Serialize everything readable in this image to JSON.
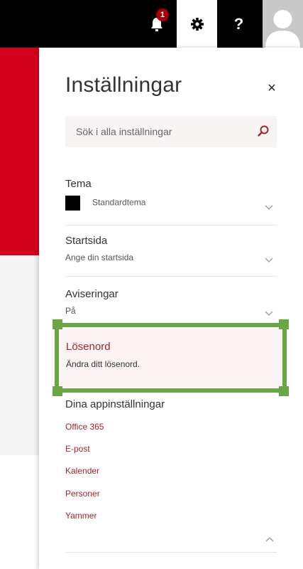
{
  "topbar": {
    "notification_count": "1",
    "help_label": "?",
    "icons": [
      "bell-icon",
      "gear-icon",
      "help-icon",
      "avatar-icon"
    ]
  },
  "settings": {
    "title": "Inställningar",
    "close_label": "×",
    "search": {
      "placeholder": "Sök i alla inställningar"
    },
    "theme": {
      "label": "Tema",
      "value": "Standardtema"
    },
    "start_page": {
      "label": "Startsida",
      "value": "Ange din startsida"
    },
    "notifications": {
      "label": "Aviseringar",
      "value": "På"
    },
    "password": {
      "label": "Lösenord",
      "value": "Ändra ditt lösenord."
    },
    "app_settings": {
      "label": "Dina appinställningar",
      "items": [
        "Office 365",
        "E-post",
        "Kalender",
        "Personer",
        "Yammer"
      ]
    }
  },
  "colors": {
    "accent": "#a4262c",
    "brand_red": "#d4001f",
    "highlight": "#6aa643"
  }
}
